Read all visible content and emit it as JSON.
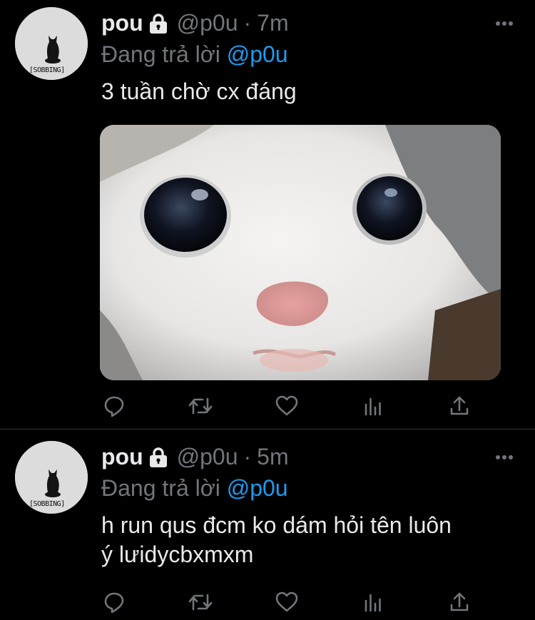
{
  "colors": {
    "background": "#000000",
    "text_primary": "#e7e9ea",
    "text_secondary": "#71767b",
    "accent": "#1d9bf0",
    "divider": "#2f3336"
  },
  "tweets": [
    {
      "avatar_tag": "[SOBBING]",
      "display_name": "pou",
      "protected_icon": "lock-icon",
      "handle": "@p0u",
      "separator": "·",
      "time": "7m",
      "replying_prefix": "Đang trả lời",
      "replying_to": "@p0u",
      "text": "3 tuần chờ cx đáng",
      "has_media": true,
      "media_icon": "crying-cat-photo",
      "more_icon": "more-dots-icon",
      "actions": [
        "reply-icon",
        "retweet-icon",
        "like-icon",
        "analytics-icon",
        "share-icon"
      ]
    },
    {
      "avatar_tag": "[SOBBING]",
      "display_name": "pou",
      "protected_icon": "lock-icon",
      "handle": "@p0u",
      "separator": "·",
      "time": "5m",
      "replying_prefix": "Đang trả lời",
      "replying_to": "@p0u",
      "text_lines": [
        "h run qus đcm ko dám hỏi tên luôn",
        "ý lưidycbxmxm"
      ],
      "has_media": false,
      "more_icon": "more-dots-icon",
      "actions": [
        "reply-icon",
        "retweet-icon",
        "like-icon",
        "analytics-icon",
        "share-icon"
      ]
    }
  ]
}
